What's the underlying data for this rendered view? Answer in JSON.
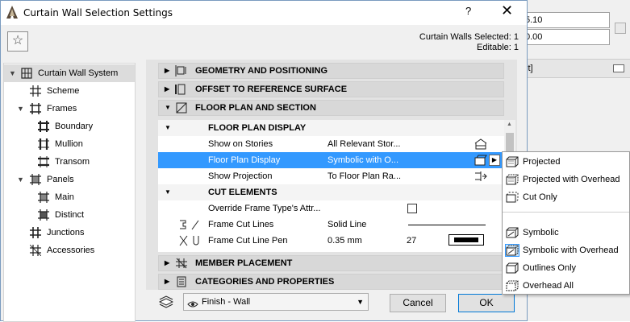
{
  "background_app": {
    "field1": "5.10",
    "field2": "0.00",
    "bar_text": "it]"
  },
  "window": {
    "title": "Curtain Wall Selection Settings",
    "help": "?",
    "close": "✕"
  },
  "favorites_star": "☆",
  "selection_info": {
    "selected": "Curtain Walls Selected: 1",
    "editable": "Editable: 1"
  },
  "tree": {
    "items": [
      {
        "label": "Curtain Wall System"
      },
      {
        "label": "Scheme"
      },
      {
        "label": "Frames"
      },
      {
        "label": "Boundary"
      },
      {
        "label": "Mullion"
      },
      {
        "label": "Transom"
      },
      {
        "label": "Panels"
      },
      {
        "label": "Main"
      },
      {
        "label": "Distinct"
      },
      {
        "label": "Junctions"
      },
      {
        "label": "Accessories"
      }
    ]
  },
  "sections": {
    "geometry": "GEOMETRY AND POSITIONING",
    "offset": "OFFSET TO REFERENCE SURFACE",
    "floor_plan": "FLOOR PLAN AND SECTION",
    "member_placement": "MEMBER PLACEMENT",
    "categories": "CATEGORIES AND PROPERTIES"
  },
  "floor_plan_rows": {
    "sub1": "FLOOR PLAN DISPLAY",
    "show_on_stories": {
      "label": "Show on Stories",
      "value": "All Relevant Stor..."
    },
    "floor_plan_display": {
      "label": "Floor Plan Display",
      "value": "Symbolic with O..."
    },
    "show_projection": {
      "label": "Show Projection",
      "value": "To Floor Plan Ra..."
    },
    "sub2": "CUT ELEMENTS",
    "override": {
      "label": "Override Frame Type's Attr..."
    },
    "frame_cut_lines": {
      "label": "Frame Cut Lines",
      "value": "Solid Line"
    },
    "frame_cut_line_pen": {
      "label": "Frame Cut Line Pen",
      "value": "0.35 mm",
      "pen": "27"
    }
  },
  "bottom": {
    "layer": "Finish - Wall",
    "cancel": "Cancel",
    "ok": "OK"
  },
  "popup": {
    "items": [
      {
        "label": "Projected"
      },
      {
        "label": "Projected with Overhead"
      },
      {
        "label": "Cut Only"
      },
      {
        "label": "Symbolic"
      },
      {
        "label": "Symbolic with Overhead"
      },
      {
        "label": "Outlines Only"
      },
      {
        "label": "Overhead All"
      }
    ]
  },
  "colors": {
    "selection": "#3399ff",
    "accent": "#0078d7"
  }
}
